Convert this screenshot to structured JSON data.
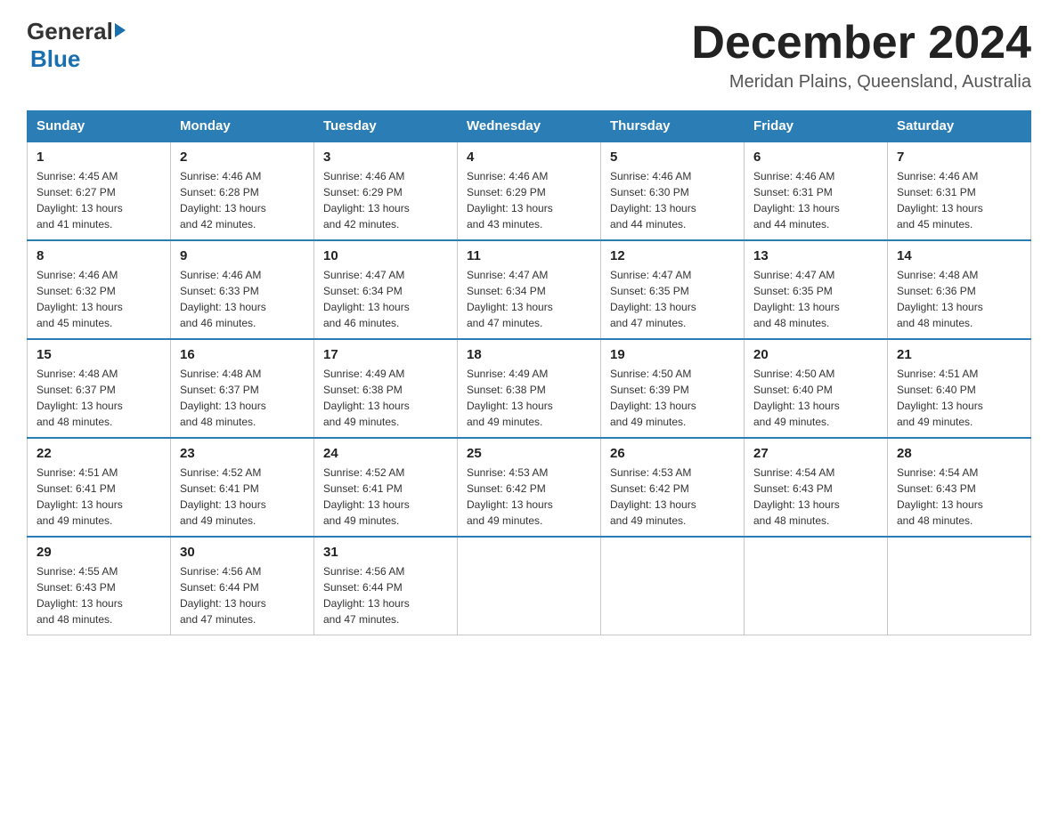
{
  "logo": {
    "general": "General",
    "blue": "Blue"
  },
  "title": "December 2024",
  "location": "Meridan Plains, Queensland, Australia",
  "days_of_week": [
    "Sunday",
    "Monday",
    "Tuesday",
    "Wednesday",
    "Thursday",
    "Friday",
    "Saturday"
  ],
  "weeks": [
    [
      {
        "day": "1",
        "sunrise": "4:45 AM",
        "sunset": "6:27 PM",
        "daylight": "13 hours and 41 minutes."
      },
      {
        "day": "2",
        "sunrise": "4:46 AM",
        "sunset": "6:28 PM",
        "daylight": "13 hours and 42 minutes."
      },
      {
        "day": "3",
        "sunrise": "4:46 AM",
        "sunset": "6:29 PM",
        "daylight": "13 hours and 42 minutes."
      },
      {
        "day": "4",
        "sunrise": "4:46 AM",
        "sunset": "6:29 PM",
        "daylight": "13 hours and 43 minutes."
      },
      {
        "day": "5",
        "sunrise": "4:46 AM",
        "sunset": "6:30 PM",
        "daylight": "13 hours and 44 minutes."
      },
      {
        "day": "6",
        "sunrise": "4:46 AM",
        "sunset": "6:31 PM",
        "daylight": "13 hours and 44 minutes."
      },
      {
        "day": "7",
        "sunrise": "4:46 AM",
        "sunset": "6:31 PM",
        "daylight": "13 hours and 45 minutes."
      }
    ],
    [
      {
        "day": "8",
        "sunrise": "4:46 AM",
        "sunset": "6:32 PM",
        "daylight": "13 hours and 45 minutes."
      },
      {
        "day": "9",
        "sunrise": "4:46 AM",
        "sunset": "6:33 PM",
        "daylight": "13 hours and 46 minutes."
      },
      {
        "day": "10",
        "sunrise": "4:47 AM",
        "sunset": "6:34 PM",
        "daylight": "13 hours and 46 minutes."
      },
      {
        "day": "11",
        "sunrise": "4:47 AM",
        "sunset": "6:34 PM",
        "daylight": "13 hours and 47 minutes."
      },
      {
        "day": "12",
        "sunrise": "4:47 AM",
        "sunset": "6:35 PM",
        "daylight": "13 hours and 47 minutes."
      },
      {
        "day": "13",
        "sunrise": "4:47 AM",
        "sunset": "6:35 PM",
        "daylight": "13 hours and 48 minutes."
      },
      {
        "day": "14",
        "sunrise": "4:48 AM",
        "sunset": "6:36 PM",
        "daylight": "13 hours and 48 minutes."
      }
    ],
    [
      {
        "day": "15",
        "sunrise": "4:48 AM",
        "sunset": "6:37 PM",
        "daylight": "13 hours and 48 minutes."
      },
      {
        "day": "16",
        "sunrise": "4:48 AM",
        "sunset": "6:37 PM",
        "daylight": "13 hours and 48 minutes."
      },
      {
        "day": "17",
        "sunrise": "4:49 AM",
        "sunset": "6:38 PM",
        "daylight": "13 hours and 49 minutes."
      },
      {
        "day": "18",
        "sunrise": "4:49 AM",
        "sunset": "6:38 PM",
        "daylight": "13 hours and 49 minutes."
      },
      {
        "day": "19",
        "sunrise": "4:50 AM",
        "sunset": "6:39 PM",
        "daylight": "13 hours and 49 minutes."
      },
      {
        "day": "20",
        "sunrise": "4:50 AM",
        "sunset": "6:40 PM",
        "daylight": "13 hours and 49 minutes."
      },
      {
        "day": "21",
        "sunrise": "4:51 AM",
        "sunset": "6:40 PM",
        "daylight": "13 hours and 49 minutes."
      }
    ],
    [
      {
        "day": "22",
        "sunrise": "4:51 AM",
        "sunset": "6:41 PM",
        "daylight": "13 hours and 49 minutes."
      },
      {
        "day": "23",
        "sunrise": "4:52 AM",
        "sunset": "6:41 PM",
        "daylight": "13 hours and 49 minutes."
      },
      {
        "day": "24",
        "sunrise": "4:52 AM",
        "sunset": "6:41 PM",
        "daylight": "13 hours and 49 minutes."
      },
      {
        "day": "25",
        "sunrise": "4:53 AM",
        "sunset": "6:42 PM",
        "daylight": "13 hours and 49 minutes."
      },
      {
        "day": "26",
        "sunrise": "4:53 AM",
        "sunset": "6:42 PM",
        "daylight": "13 hours and 49 minutes."
      },
      {
        "day": "27",
        "sunrise": "4:54 AM",
        "sunset": "6:43 PM",
        "daylight": "13 hours and 48 minutes."
      },
      {
        "day": "28",
        "sunrise": "4:54 AM",
        "sunset": "6:43 PM",
        "daylight": "13 hours and 48 minutes."
      }
    ],
    [
      {
        "day": "29",
        "sunrise": "4:55 AM",
        "sunset": "6:43 PM",
        "daylight": "13 hours and 48 minutes."
      },
      {
        "day": "30",
        "sunrise": "4:56 AM",
        "sunset": "6:44 PM",
        "daylight": "13 hours and 47 minutes."
      },
      {
        "day": "31",
        "sunrise": "4:56 AM",
        "sunset": "6:44 PM",
        "daylight": "13 hours and 47 minutes."
      },
      null,
      null,
      null,
      null
    ]
  ],
  "labels": {
    "sunrise": "Sunrise:",
    "sunset": "Sunset:",
    "daylight": "Daylight:"
  }
}
